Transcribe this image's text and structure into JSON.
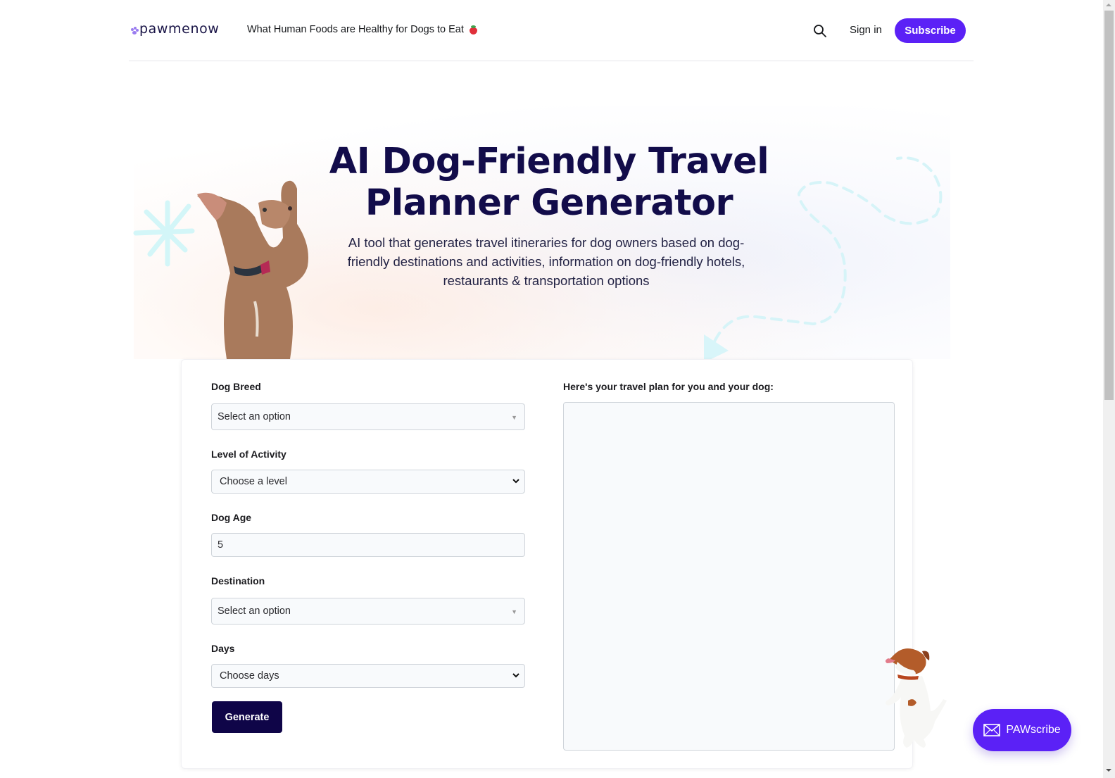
{
  "header": {
    "logo_text": "pawmenow",
    "nav_link": "What Human Foods are Healthy for Dogs to Eat",
    "nav_link_icon": "strawberry-icon",
    "search_icon": "search-icon",
    "signin_label": "Sign in",
    "subscribe_label": "Subscribe"
  },
  "hero": {
    "title": "AI Dog-Friendly Travel Planner Generator",
    "subtitle": "AI tool that generates travel itineraries for dog owners based on dog-friendly destinations and activities, information on dog-friendly hotels, restaurants & transportation options"
  },
  "form": {
    "fields": [
      {
        "label": "Dog Breed",
        "type": "searchable-select",
        "value": "Select an option"
      },
      {
        "label": "Level of Activity",
        "type": "select",
        "value": "Choose a level"
      },
      {
        "label": "Dog Age",
        "type": "number",
        "value": "5"
      },
      {
        "label": "Destination",
        "type": "searchable-select",
        "value": "Select an option"
      },
      {
        "label": "Days",
        "type": "select",
        "value": "Choose days"
      }
    ],
    "generate_label": "Generate"
  },
  "result": {
    "label": "Here's your travel plan for you and your dog:",
    "content": ""
  },
  "floating": {
    "pawscribe_label": "PAWscribe",
    "pawscribe_icon": "envelope-icon"
  },
  "colors": {
    "brand_purple": "#5b21f6",
    "navy": "#120c4a",
    "generate_bg": "#0f0548"
  }
}
